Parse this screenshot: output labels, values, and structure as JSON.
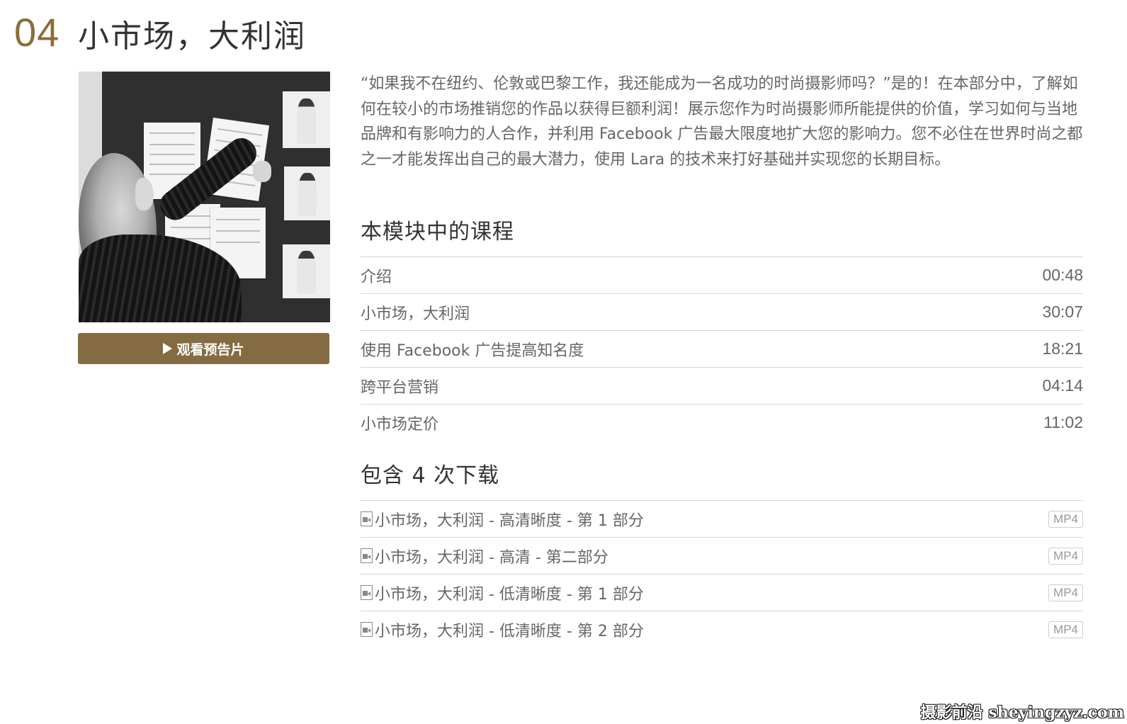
{
  "module": {
    "number": "04",
    "title": "小市场，大利润"
  },
  "trailer_button": {
    "label": "观看预告片",
    "icon": "play-icon"
  },
  "description": "“如果我不在纽约、伦敦或巴黎工作，我还能成为一名成功的时尚摄影师吗？”是的！在本部分中，了解如何在较小的市场推销您的作品以获得巨额利润！展示您作为时尚摄影师所能提供的价值，学习如何与当地品牌和有影响力的人合作，并利用 Facebook 广告最大限度地扩大您的影响力。您不必住在世界时尚之都之一才能发挥出自己的最大潜力，使用 Lara 的技术来打好基础并实现您的长期目标。",
  "lessons": {
    "heading": "本模块中的课程",
    "items": [
      {
        "title": "介绍",
        "duration": "00:48"
      },
      {
        "title": "小市场，大利润",
        "duration": "30:07"
      },
      {
        "title": "使用 Facebook 广告提高知名度",
        "duration": "18:21"
      },
      {
        "title": "跨平台营销",
        "duration": "04:14"
      },
      {
        "title": "小市场定价",
        "duration": "11:02"
      }
    ]
  },
  "downloads": {
    "heading": "包含 4 次下载",
    "items": [
      {
        "title": "小市场，大利润 - 高清晰度 - 第 1 部分",
        "format": "MP4",
        "icon": "video-file-icon"
      },
      {
        "title": "小市场，大利润 - 高清 - 第二部分",
        "format": "MP4",
        "icon": "video-file-icon"
      },
      {
        "title": "小市场，大利润 - 低清晰度 - 第 1 部分",
        "format": "MP4",
        "icon": "video-file-icon"
      },
      {
        "title": "小市场，大利润 - 低清晰度 - 第 2 部分",
        "format": "MP4",
        "icon": "video-file-icon"
      }
    ]
  },
  "watermark": "摄影前沿 sheyingzyz.com",
  "colors": {
    "accent": "#856b42",
    "number": "#8a6d3b",
    "text": "#666666",
    "heading": "#333333",
    "divider": "#d6d6d6"
  }
}
